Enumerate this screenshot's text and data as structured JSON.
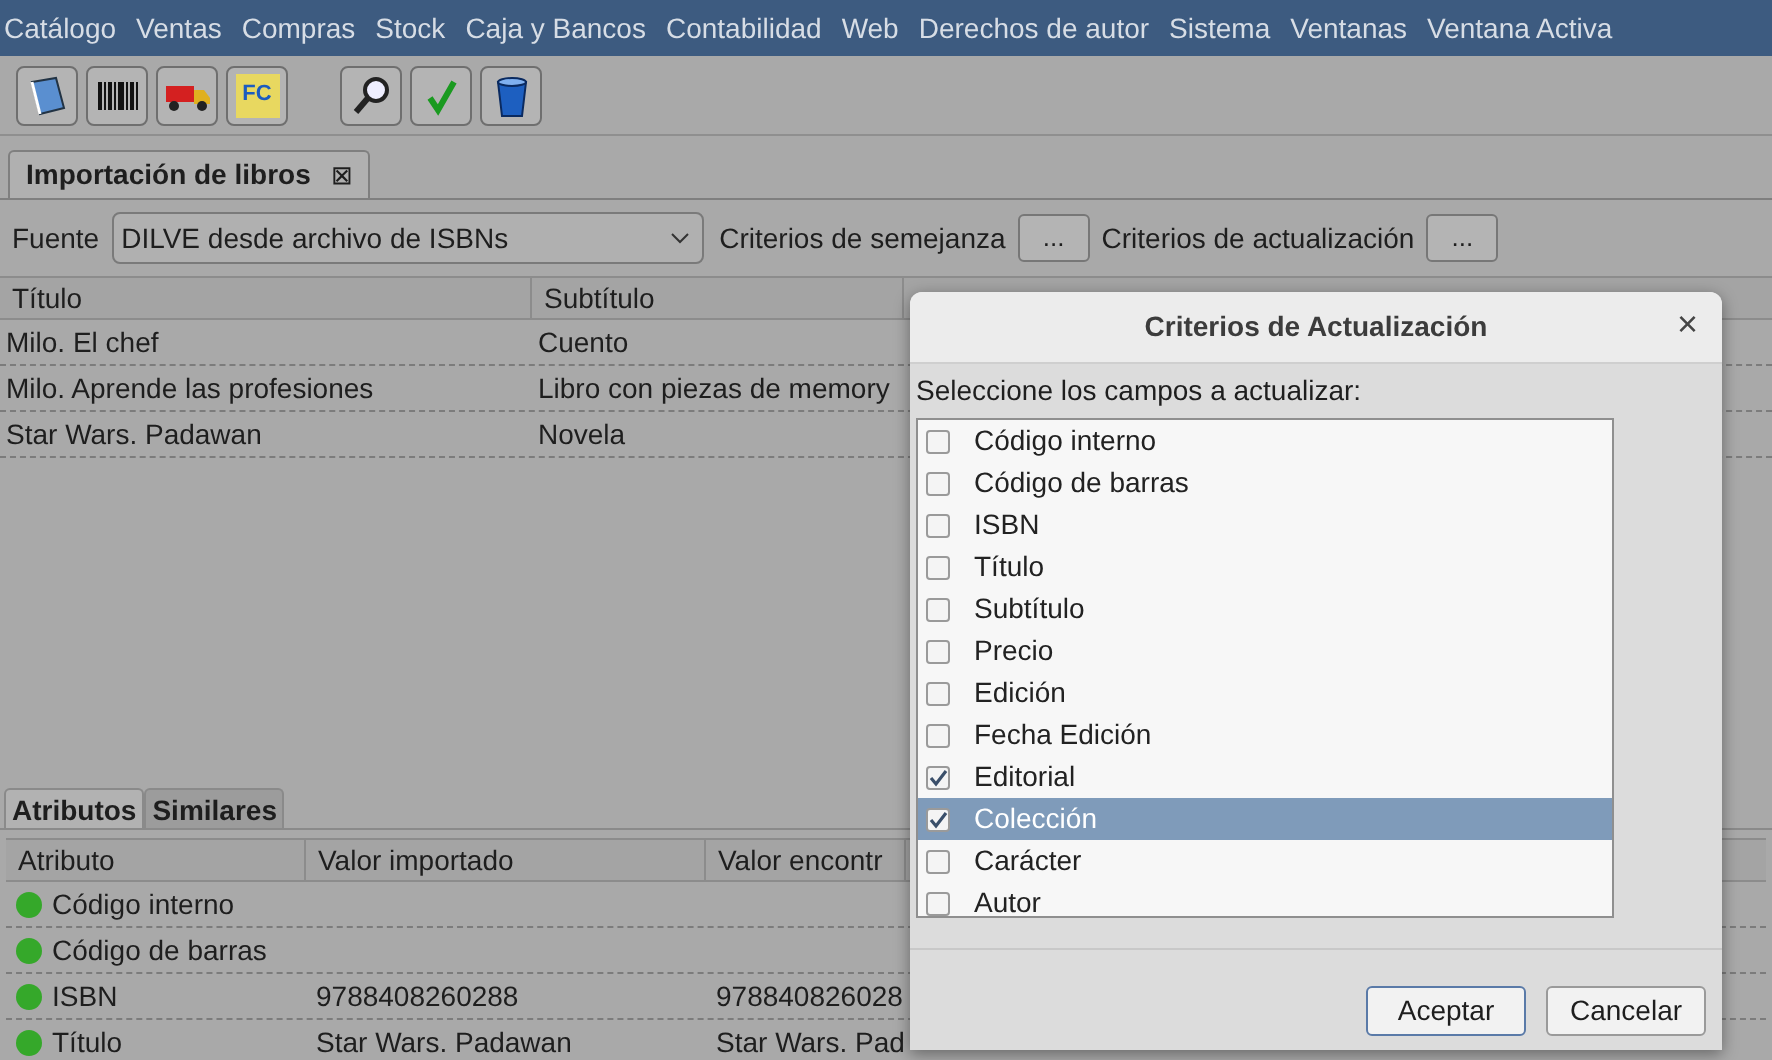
{
  "menu": [
    "Catálogo",
    "Ventas",
    "Compras",
    "Stock",
    "Caja y Bancos",
    "Contabilidad",
    "Web",
    "Derechos de autor",
    "Sistema",
    "Ventanas",
    "Ventana Activa"
  ],
  "toolbar": [
    {
      "kind": "book"
    },
    {
      "kind": "barcode"
    },
    {
      "kind": "truck"
    },
    {
      "kind": "fc",
      "label": "FC"
    },
    {
      "kind": "gap"
    },
    {
      "kind": "search"
    },
    {
      "kind": "check"
    },
    {
      "kind": "bin"
    }
  ],
  "document_tabs": [
    {
      "label": "Importación de libros",
      "selected": true,
      "close": "⊠"
    }
  ],
  "source": {
    "label": "Fuente",
    "value": "DILVE desde archivo de ISBNs",
    "similarity_label": "Criterios de semejanza",
    "similarity_button": "...",
    "update_label": "Criterios de actualización",
    "update_button": "..."
  },
  "books_table": {
    "columns": [
      "Título",
      "Subtítulo"
    ],
    "rows": [
      [
        "Milo. El chef",
        "Cuento"
      ],
      [
        "Milo. Aprende las profesiones",
        "Libro con piezas de memory"
      ],
      [
        "Star Wars. Padawan",
        "Novela"
      ]
    ]
  },
  "detail_tabs": [
    {
      "label": "Atributos",
      "selected": true
    },
    {
      "label": "Similares",
      "selected": false
    }
  ],
  "attributes_table": {
    "columns": [
      "Atributo",
      "Valor importado",
      "Valor encontr"
    ],
    "rows": [
      {
        "color": "#35a82a",
        "cells": [
          "Código interno",
          "",
          ""
        ]
      },
      {
        "color": "#35a82a",
        "cells": [
          "Código de barras",
          "",
          ""
        ]
      },
      {
        "color": "#35a82a",
        "cells": [
          "ISBN",
          "9788408260288",
          "978840826028"
        ]
      },
      {
        "color": "#35a82a",
        "cells": [
          "Título",
          "Star Wars. Padawan",
          "Star Wars. Pad"
        ]
      }
    ]
  },
  "dialog": {
    "title": "Criterios de Actualización",
    "close": "×",
    "prompt": "Seleccione los campos a actualizar:",
    "fields": [
      {
        "label": "Código interno",
        "checked": false,
        "selected": false
      },
      {
        "label": "Código de barras",
        "checked": false,
        "selected": false
      },
      {
        "label": "ISBN",
        "checked": false,
        "selected": false
      },
      {
        "label": "Título",
        "checked": false,
        "selected": false
      },
      {
        "label": "Subtítulo",
        "checked": false,
        "selected": false
      },
      {
        "label": "Precio",
        "checked": false,
        "selected": false
      },
      {
        "label": "Edición",
        "checked": false,
        "selected": false
      },
      {
        "label": "Fecha Edición",
        "checked": false,
        "selected": false
      },
      {
        "label": "Editorial",
        "checked": true,
        "selected": false
      },
      {
        "label": "Colección",
        "checked": true,
        "selected": true
      },
      {
        "label": "Carácter",
        "checked": false,
        "selected": false
      },
      {
        "label": "Autor",
        "checked": false,
        "selected": false
      }
    ],
    "buttons": [
      {
        "label": "Aceptar",
        "default": true
      },
      {
        "label": "Cancelar",
        "default": false
      }
    ]
  }
}
